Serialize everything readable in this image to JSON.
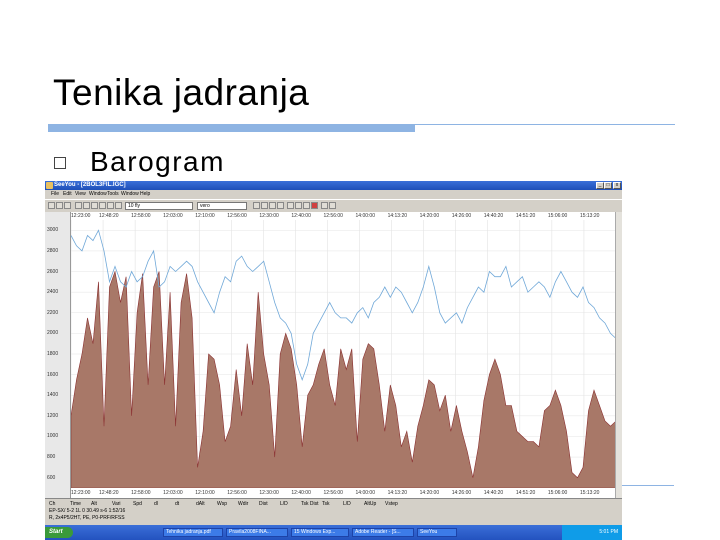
{
  "slide": {
    "title": "Tenika jadranja",
    "bullet": "Barogram"
  },
  "window": {
    "title": "SeeYou - [2BOL3FIL.IGC]",
    "minimize": "_",
    "maximize": "□",
    "close": "x"
  },
  "menu": [
    "File",
    "Edit",
    "View",
    "Window",
    "Tools",
    "Window",
    "Help"
  ],
  "toolbar": {
    "field1": "10 fly",
    "field2": "vero"
  },
  "chart_data": {
    "type": "area",
    "y_ticks": [
      "3000",
      "2800",
      "2600",
      "2400",
      "2200",
      "2000",
      "1800",
      "1600",
      "1400",
      "1200",
      "1000",
      "800",
      "600"
    ],
    "x_ticks": [
      "12:23:00",
      "12:48:20",
      "12:58:00",
      "12:03:00",
      "12:10:00",
      "12:56:00",
      "12:30:00",
      "12:40:00",
      "12:56:00",
      "14:00:00",
      "14:13:20",
      "14:20:00",
      "14:26:00",
      "14:40:20",
      "14:51:20",
      "15:06:00",
      "15:13:20",
      "15:22:00"
    ],
    "ylim": [
      500,
      3100
    ],
    "series": [
      {
        "color": "#a87868",
        "values": [
          1200,
          1550,
          1800,
          2150,
          1900,
          2500,
          1100,
          2450,
          2600,
          2300,
          2550,
          1200,
          2200,
          2580,
          1500,
          2450,
          2600,
          1500,
          2400,
          1100,
          2300,
          2580,
          2150,
          700,
          1050,
          1800,
          1750,
          1500,
          950,
          1100,
          1650,
          1200,
          1900,
          1500,
          2400,
          1800,
          1500,
          800,
          1800,
          2000,
          1850,
          1500,
          900,
          1400,
          1500,
          1700,
          1850,
          1500,
          1300,
          1850,
          1650,
          1850,
          950,
          1750,
          1900,
          1850,
          1500,
          1050,
          1500,
          1300,
          900,
          1050,
          750,
          1100,
          1300,
          1550,
          1500,
          1250,
          1400,
          1050,
          1300,
          1050,
          850,
          600,
          900,
          1350,
          1600,
          1750,
          1600,
          1300,
          1300,
          1050,
          1000,
          950,
          950,
          900,
          1250,
          1300,
          1450,
          1300,
          1050,
          650,
          600,
          700,
          1250,
          1450,
          1300,
          1150,
          1100,
          1150
        ]
      },
      {
        "color": "#70a8d8",
        "values": [
          2950,
          2850,
          2800,
          2950,
          2900,
          3000,
          2800,
          2500,
          2650,
          2500,
          2450,
          2600,
          2500,
          2550,
          2700,
          2800,
          2450,
          2500,
          2650,
          2600,
          2650,
          2700,
          2650,
          2500,
          2400,
          2300,
          2200,
          2400,
          2550,
          2500,
          2700,
          2750,
          2650,
          2600,
          2650,
          2700,
          2500,
          2300,
          2150,
          2100,
          2000,
          1700,
          1550,
          1700,
          2000,
          2100,
          2200,
          2300,
          2200,
          2150,
          2150,
          2100,
          2200,
          2250,
          2150,
          2300,
          2350,
          2450,
          2350,
          2450,
          2400,
          2300,
          2200,
          2300,
          2450,
          2650,
          2450,
          2200,
          2100,
          2150,
          2200,
          2100,
          2250,
          2350,
          2450,
          2400,
          2600,
          2550,
          2550,
          2650,
          2450,
          2500,
          2550,
          2400,
          2450,
          2500,
          2450,
          2350,
          2500,
          2600,
          2500,
          2400,
          2350,
          2450,
          2300,
          2250,
          2150,
          2100,
          2000,
          1950
        ]
      }
    ]
  },
  "status": {
    "row1": [
      "Ch",
      "Time",
      "Alt",
      "Vari",
      "Spd",
      "dl",
      "dt",
      "dAlt",
      "Wsp",
      "Wdir",
      "Dist",
      "L/D",
      "Tsk Dist",
      "Tsk",
      "L/D",
      "AltUp",
      "Vstep"
    ],
    "row2": "EP-SX/ 5-2 1L 0 30.49 s-6 1:52/16",
    "row3": "R, 2x4P5/2HT, PE, P0-PRF/RFSS"
  },
  "taskbar": {
    "start": "Start",
    "items": [
      "Tehnika jadranja.pdf",
      "Pravila2008FINA...",
      "15 Windows Exp...",
      "Adobe Reader - [S...",
      "SeeYou"
    ],
    "clock": "5:01 PM"
  }
}
